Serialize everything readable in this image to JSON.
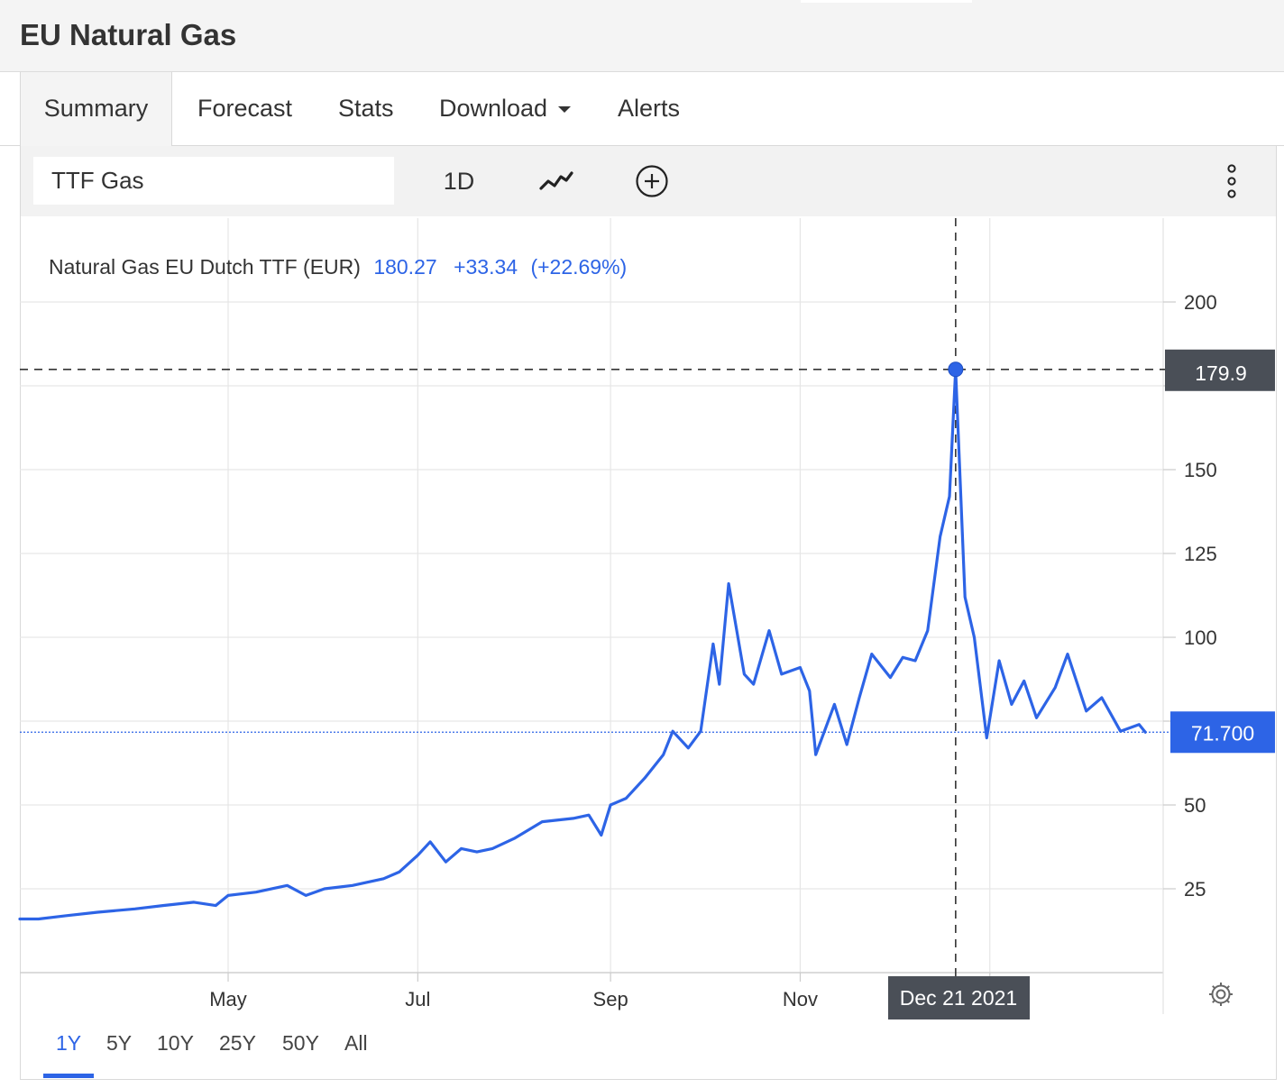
{
  "header": {
    "title": "EU Natural Gas"
  },
  "tabs": [
    {
      "label": "Summary",
      "active": true
    },
    {
      "label": "Forecast"
    },
    {
      "label": "Stats"
    },
    {
      "label": "Download"
    },
    {
      "label": "Alerts"
    }
  ],
  "toolbar": {
    "symbol": "TTF Gas",
    "interval": "1D",
    "chart_type_icon": "line-chart-icon",
    "compare_icon": "plus-circle-icon",
    "menu_icon": "more-vertical-icon"
  },
  "legend": {
    "name": "Natural Gas EU Dutch TTF (EUR)",
    "value": "180.27",
    "change": "+33.34",
    "change_pct": "(+22.69%)"
  },
  "crosshair": {
    "price_label": "179.9",
    "date_label": "Dec 21 2021",
    "price": 179.9
  },
  "last_price": {
    "label": "71.700",
    "value": 71.7
  },
  "ranges": [
    {
      "label": "1Y",
      "active": true
    },
    {
      "label": "5Y"
    },
    {
      "label": "10Y"
    },
    {
      "label": "25Y"
    },
    {
      "label": "50Y"
    },
    {
      "label": "All"
    }
  ],
  "settings_icon": "gear-icon",
  "colors": {
    "line": "#2d64e6",
    "accent": "#2d64e6",
    "tag_dark": "#4a4f57"
  },
  "chart_data": {
    "type": "line",
    "title": "Natural Gas EU Dutch TTF (EUR)",
    "ylim": [
      0,
      225
    ],
    "y_ticks": [
      25,
      50,
      75,
      100,
      125,
      150,
      175,
      200
    ],
    "y_tick_labels": [
      "25",
      "50",
      "",
      "100",
      "125",
      "150",
      "",
      "200"
    ],
    "x_ticks": [
      {
        "label": "May",
        "date": "2021-05-01"
      },
      {
        "label": "Jul",
        "date": "2021-07-01"
      },
      {
        "label": "Sep",
        "date": "2021-09-01"
      },
      {
        "label": "Nov",
        "date": "2021-11-01"
      },
      {
        "label": "",
        "date": "2022-01-01"
      }
    ],
    "xlim": [
      "2021-02-23",
      "2022-02-24"
    ],
    "grid": true,
    "series": [
      {
        "values": [
          [
            "2021-02-23",
            16
          ],
          [
            "2021-03-01",
            16
          ],
          [
            "2021-03-10",
            17
          ],
          [
            "2021-03-20",
            18
          ],
          [
            "2021-04-01",
            19
          ],
          [
            "2021-04-10",
            20
          ],
          [
            "2021-04-20",
            21
          ],
          [
            "2021-04-27",
            20
          ],
          [
            "2021-05-01",
            23
          ],
          [
            "2021-05-10",
            24
          ],
          [
            "2021-05-20",
            26
          ],
          [
            "2021-05-26",
            23
          ],
          [
            "2021-06-01",
            25
          ],
          [
            "2021-06-10",
            26
          ],
          [
            "2021-06-20",
            28
          ],
          [
            "2021-06-25",
            30
          ],
          [
            "2021-07-01",
            35
          ],
          [
            "2021-07-05",
            39
          ],
          [
            "2021-07-10",
            33
          ],
          [
            "2021-07-15",
            37
          ],
          [
            "2021-07-20",
            36
          ],
          [
            "2021-07-25",
            37
          ],
          [
            "2021-08-01",
            40
          ],
          [
            "2021-08-10",
            45
          ],
          [
            "2021-08-20",
            46
          ],
          [
            "2021-08-25",
            47
          ],
          [
            "2021-08-29",
            41
          ],
          [
            "2021-09-01",
            50
          ],
          [
            "2021-09-06",
            52
          ],
          [
            "2021-09-12",
            58
          ],
          [
            "2021-09-18",
            65
          ],
          [
            "2021-09-21",
            72
          ],
          [
            "2021-09-26",
            67
          ],
          [
            "2021-09-30",
            72
          ],
          [
            "2021-10-04",
            98
          ],
          [
            "2021-10-06",
            86
          ],
          [
            "2021-10-09",
            116
          ],
          [
            "2021-10-14",
            89
          ],
          [
            "2021-10-17",
            86
          ],
          [
            "2021-10-22",
            102
          ],
          [
            "2021-10-26",
            89
          ],
          [
            "2021-11-01",
            91
          ],
          [
            "2021-11-04",
            84
          ],
          [
            "2021-11-06",
            65
          ],
          [
            "2021-11-12",
            80
          ],
          [
            "2021-11-16",
            68
          ],
          [
            "2021-11-20",
            82
          ],
          [
            "2021-11-24",
            95
          ],
          [
            "2021-11-30",
            88
          ],
          [
            "2021-12-04",
            94
          ],
          [
            "2021-12-08",
            93
          ],
          [
            "2021-12-12",
            102
          ],
          [
            "2021-12-16",
            130
          ],
          [
            "2021-12-19",
            142
          ],
          [
            "2021-12-21",
            179.9
          ],
          [
            "2021-12-24",
            112
          ],
          [
            "2021-12-27",
            100
          ],
          [
            "2021-12-31",
            70
          ],
          [
            "2022-01-04",
            93
          ],
          [
            "2022-01-08",
            80
          ],
          [
            "2022-01-12",
            87
          ],
          [
            "2022-01-16",
            76
          ],
          [
            "2022-01-22",
            85
          ],
          [
            "2022-01-26",
            95
          ],
          [
            "2022-02-01",
            78
          ],
          [
            "2022-02-06",
            82
          ],
          [
            "2022-02-12",
            72
          ],
          [
            "2022-02-18",
            74
          ],
          [
            "2022-02-20",
            71.7
          ]
        ]
      }
    ]
  }
}
